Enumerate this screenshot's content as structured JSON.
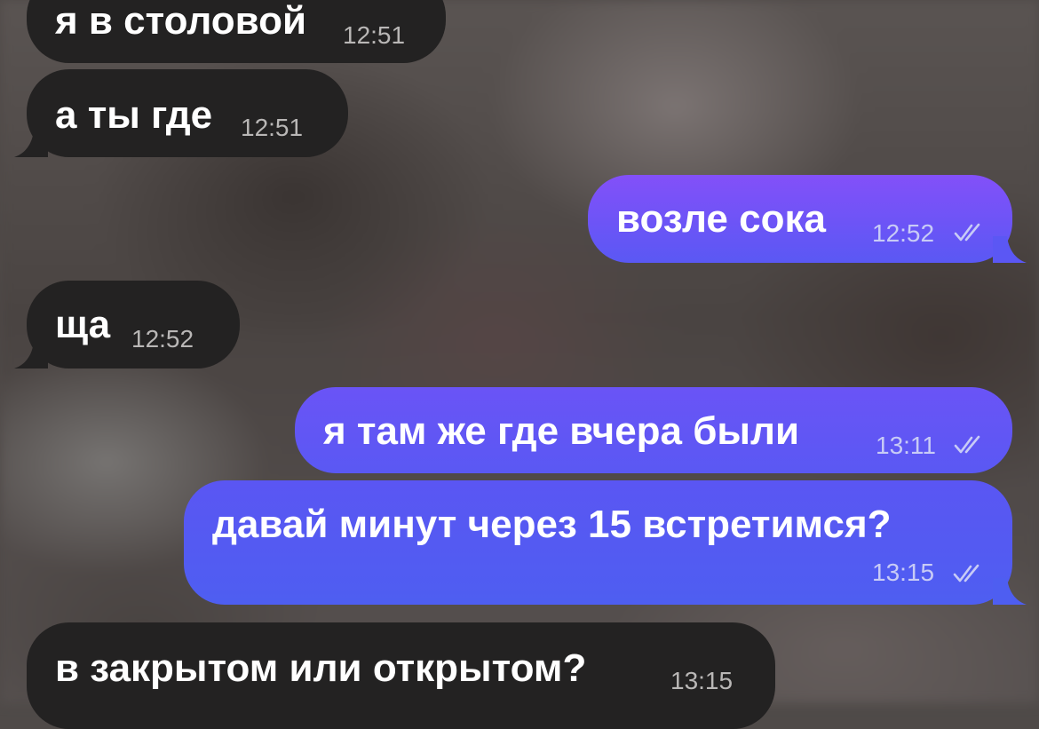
{
  "messages": [
    {
      "direction": "incoming",
      "text": "я в столовой",
      "time": "12:51"
    },
    {
      "direction": "incoming",
      "text": "а ты где",
      "time": "12:51"
    },
    {
      "direction": "outgoing",
      "text": "возле сока",
      "time": "12:52",
      "status_icon": "double-check-icon"
    },
    {
      "direction": "incoming",
      "text": "ща",
      "time": "12:52"
    },
    {
      "direction": "outgoing",
      "text": "я там же где вчера были",
      "time": "13:11",
      "status_icon": "double-check-icon"
    },
    {
      "direction": "outgoing",
      "text": "давай минут через 15 встретимся?",
      "time": "13:15",
      "status_icon": "double-check-icon"
    },
    {
      "direction": "incoming",
      "text": "в закрытом или открытом?",
      "time": "13:15"
    }
  ],
  "colors": {
    "incoming_bubble": "#232222",
    "outgoing_top": "#8350f9",
    "outgoing_bottom": "#4e5ef1",
    "text": "#ffffff",
    "incoming_time": "#b9b7b6",
    "outgoing_time": "#c8cbf6"
  }
}
